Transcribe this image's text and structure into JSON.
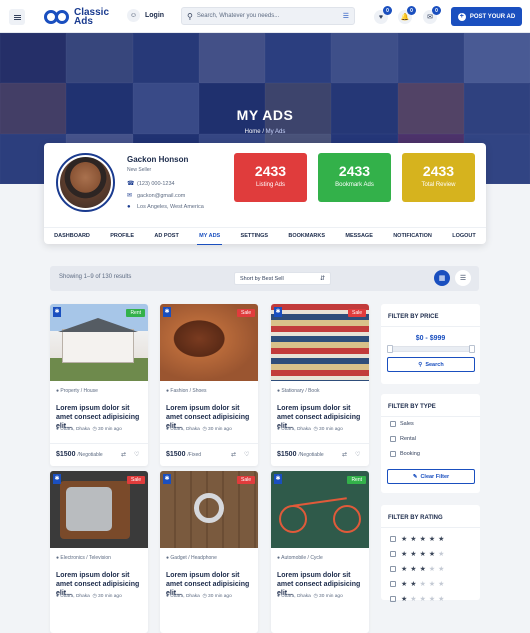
{
  "header": {
    "logo_text": "Classic\nAds",
    "login_label": "Login",
    "search_placeholder": "Search, Whatever you needs...",
    "badges": {
      "wishlist": "0",
      "notifications": "0",
      "messages": "0"
    },
    "post_label": "POST YOUR AD"
  },
  "hero": {
    "title": "MY ADS",
    "crumb_home": "Home",
    "crumb_sep": "/",
    "crumb_current": "My Ads"
  },
  "profile": {
    "name": "Gackon Honson",
    "role": "New Seller",
    "phone": "(123) 000-1234",
    "email": "gackon@gmail.com",
    "location": "Los Angeles, West America",
    "stats": [
      {
        "value": "2433",
        "label": "Listing Ads",
        "color": "#e03c3c"
      },
      {
        "value": "2433",
        "label": "Bookmark Ads",
        "color": "#33b14a"
      },
      {
        "value": "2433",
        "label": "Total Review",
        "color": "#d6b31e"
      }
    ],
    "tabs": [
      "DASHBOARD",
      "PROFILE",
      "AD POST",
      "MY ADS",
      "SETTINGS",
      "BOOKMARKS",
      "MESSAGE",
      "NOTIFICATION",
      "LOGOUT"
    ],
    "active_tab": "MY ADS"
  },
  "listing": {
    "showing": "Showing 1–9 of 130 results",
    "sort": "Short by Best Sell"
  },
  "cards": [
    {
      "badge": "Rent",
      "cat": "Property / House",
      "title": "Lorem ipsum dolor sit amet consect adipisicing elit...",
      "loc": "Uttara, Dhaka",
      "time": "30 min ago",
      "price": "$1500",
      "price_note": "/Negotiable"
    },
    {
      "badge": "Sale",
      "cat": "Fashion / Shoes",
      "title": "Lorem ipsum dolor sit amet consect adipisicing elit...",
      "loc": "Uttara, Dhaka",
      "time": "30 min ago",
      "price": "$1500",
      "price_note": "/Fixed"
    },
    {
      "badge": "Sale",
      "cat": "Stationary / Book",
      "title": "Lorem ipsum dolor sit amet consect adipisicing elit...",
      "loc": "Uttara, Dhaka",
      "time": "30 min ago",
      "price": "$1500",
      "price_note": "/Negotiable"
    },
    {
      "badge": "Sale",
      "cat": "Electronics / Television",
      "title": "Lorem ipsum dolor sit amet consect adipisicing elit...",
      "loc": "Uttara, Dhaka",
      "time": "30 min ago",
      "price": "",
      "price_note": ""
    },
    {
      "badge": "Sale",
      "cat": "Gadget / Headphone",
      "title": "Lorem ipsum dolor sit amet consect adipisicing elit...",
      "loc": "Uttara, Dhaka",
      "time": "30 min ago",
      "price": "",
      "price_note": ""
    },
    {
      "badge": "Rent",
      "cat": "Automobile / Cycle",
      "title": "Lorem ipsum dolor sit amet consect adipisicing elit...",
      "loc": "Uttara, Dhaka",
      "time": "30 min ago",
      "price": "",
      "price_note": ""
    }
  ],
  "sidebar": {
    "price_title": "FILTER BY PRICE",
    "price_range": "$0 - $999",
    "search_label": "Search",
    "type_title": "FILTER BY TYPE",
    "types": [
      "Sales",
      "Rental",
      "Booking"
    ],
    "clear_label": "Clear Filter",
    "rating_title": "FILTER BY RATING",
    "ratings": [
      5,
      4,
      3,
      2,
      1
    ]
  }
}
